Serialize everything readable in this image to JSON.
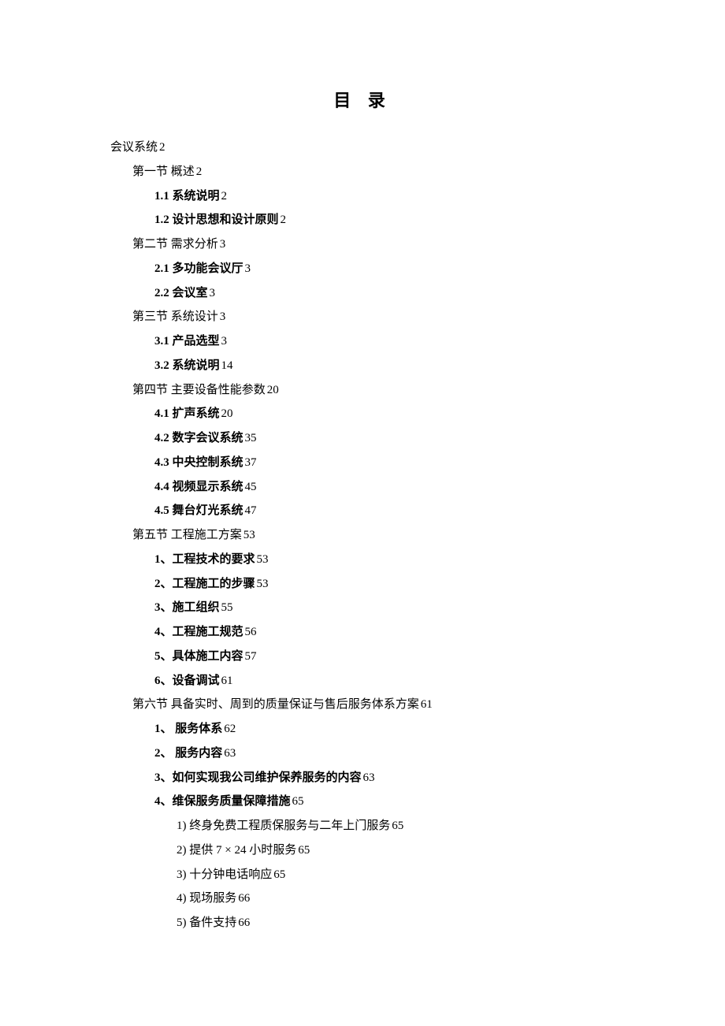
{
  "title": "目 录",
  "toc": [
    {
      "level": 0,
      "label": "会议系统",
      "page": "2",
      "bold": false
    },
    {
      "level": 1,
      "label": "第一节  概述",
      "page": "2",
      "bold": false
    },
    {
      "level": 2,
      "label": "1.1  系统说明",
      "page": "2",
      "bold": true
    },
    {
      "level": 2,
      "label": "1.2  设计思想和设计原则",
      "page": "2",
      "bold": true
    },
    {
      "level": 1,
      "label": "第二节  需求分析",
      "page": "3",
      "bold": false
    },
    {
      "level": 2,
      "label": "2.1 多功能会议厅",
      "page": "3",
      "bold": true
    },
    {
      "level": 2,
      "label": "2.2 会议室",
      "page": "3",
      "bold": true
    },
    {
      "level": 1,
      "label": "第三节  系统设计",
      "page": "3",
      "bold": false
    },
    {
      "level": 2,
      "label": "3.1  产品选型",
      "page": "3",
      "bold": true
    },
    {
      "level": 2,
      "label": "3.2  系统说明",
      "page": "14",
      "bold": true
    },
    {
      "level": 1,
      "label": "第四节  主要设备性能参数",
      "page": "20",
      "bold": false
    },
    {
      "level": 2,
      "label": "4.1  扩声系统",
      "page": "20",
      "bold": true
    },
    {
      "level": 2,
      "label": "4.2  数字会议系统",
      "page": "35",
      "bold": true
    },
    {
      "level": 2,
      "label": "4.3  中央控制系统",
      "page": "37",
      "bold": true
    },
    {
      "level": 2,
      "label": "4.4 视频显示系统",
      "page": "45",
      "bold": true
    },
    {
      "level": 2,
      "label": "4.5 舞台灯光系统",
      "page": "47",
      "bold": true
    },
    {
      "level": 1,
      "label": "第五节    工程施工方案",
      "page": "53",
      "bold": false
    },
    {
      "level": 2,
      "label": "1、工程技术的要求",
      "page": "53",
      "bold": true
    },
    {
      "level": 2,
      "label": "2、工程施工的步骤",
      "page": "53",
      "bold": true
    },
    {
      "level": 2,
      "label": "3、施工组织",
      "page": "55",
      "bold": true
    },
    {
      "level": 2,
      "label": "4、工程施工规范",
      "page": "56",
      "bold": true
    },
    {
      "level": 2,
      "label": "5、具体施工内容",
      "page": "57",
      "bold": true
    },
    {
      "level": 2,
      "label": "6、设备调试",
      "page": "61",
      "bold": true
    },
    {
      "level": 1,
      "label": "第六节    具备实时、周到的质量保证与售后服务体系方案",
      "page": "61",
      "bold": false
    },
    {
      "level": 2,
      "label": "1、  服务体系",
      "page": "62",
      "bold": true
    },
    {
      "level": 2,
      "label": "2、  服务内容",
      "page": "63",
      "bold": true
    },
    {
      "level": 2,
      "label": "3、如何实现我公司维护保养服务的内容",
      "page": "63",
      "bold": true
    },
    {
      "level": 2,
      "label": "4、维保服务质量保障措施",
      "page": "65",
      "bold": true
    },
    {
      "level": 3,
      "label": "1)    终身免费工程质保服务与二年上门服务",
      "page": "65",
      "bold": false
    },
    {
      "level": 3,
      "label": "2)    提供 7 × 24 小时服务",
      "page": "65",
      "bold": false
    },
    {
      "level": 3,
      "label": "3)    十分钟电话响应",
      "page": "65",
      "bold": false
    },
    {
      "level": 3,
      "label": "4)    现场服务",
      "page": "66",
      "bold": false
    },
    {
      "level": 3,
      "label": "5)    备件支持",
      "page": "66",
      "bold": false
    }
  ]
}
